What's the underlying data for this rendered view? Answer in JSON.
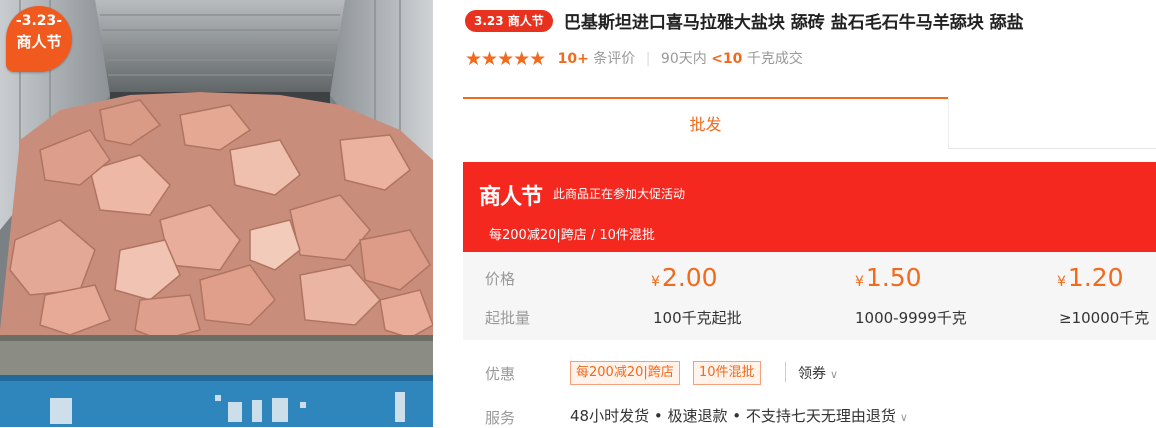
{
  "promo_badge": {
    "date": "-3.23-",
    "name": "商人节"
  },
  "product": {
    "tag": "3.23 商人节",
    "title": "巴基斯坦进口喜马拉雅大盐块 舔砖 盐石毛石牛马羊舔块 舔盐"
  },
  "rating": {
    "stars": "★★★★★",
    "review_count": "10+",
    "review_label": "条评价",
    "sales_prefix": "90天内",
    "sales_value": "<10",
    "sales_unit": "千克成交"
  },
  "tabs": {
    "wholesale": "批发"
  },
  "promo_banner": {
    "logo": "商人节",
    "description": "此商品正在参加大促活动",
    "rules": "每200减20|跨店 / 10件混批"
  },
  "pricing": {
    "price_label": "价格",
    "qty_label": "起批量",
    "currency": "¥",
    "tiers": [
      {
        "price": "2.00",
        "quantity": "100千克起批"
      },
      {
        "price": "1.50",
        "quantity": "1000-9999千克"
      },
      {
        "price": "1.20",
        "quantity": "≥10000千克"
      }
    ]
  },
  "discount": {
    "label": "优惠",
    "coupons": [
      "每200减20|跨店",
      "10件混批"
    ],
    "get_coupon": "领券"
  },
  "service": {
    "label": "服务",
    "text": "48小时发货 • 极速退款 • 不支持七天无理由退货"
  },
  "colors": {
    "accent": "#f26a1b",
    "banner_red": "#f52820",
    "tag_red": "#e8321f"
  }
}
